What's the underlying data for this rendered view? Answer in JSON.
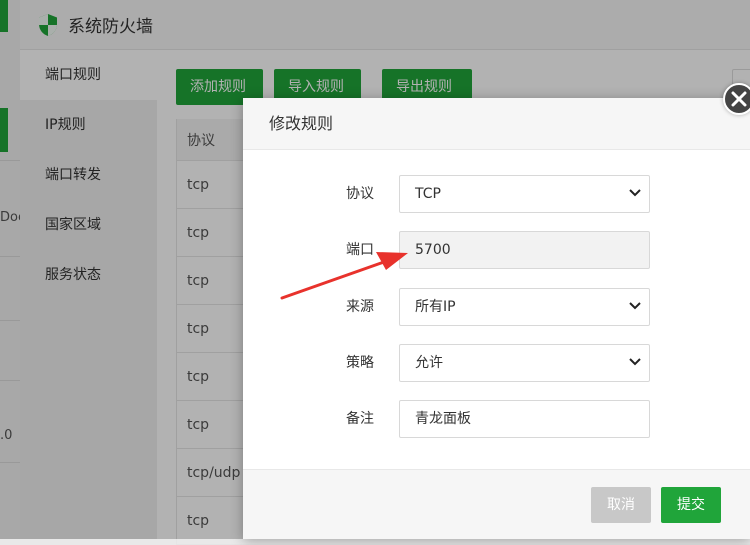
{
  "background_strip": {
    "row_a": "Doc",
    "row_b": ".0"
  },
  "window": {
    "title": "系统防火墙",
    "icon": "shield-icon"
  },
  "sidebar": {
    "items": [
      {
        "label": "端口规则",
        "active": true
      },
      {
        "label": "IP规则",
        "active": false
      },
      {
        "label": "端口转发",
        "active": false
      },
      {
        "label": "国家区域",
        "active": false
      },
      {
        "label": "服务状态",
        "active": false
      }
    ]
  },
  "toolbar": {
    "add_label": "添加规则",
    "import_label": "导入规则",
    "export_label": "导出规则"
  },
  "table": {
    "header": "协议",
    "rows": [
      {
        "protocol": "tcp",
        "tail": "1"
      },
      {
        "protocol": "tcp",
        "tail": "1"
      },
      {
        "protocol": "tcp",
        "tail": "1"
      },
      {
        "protocol": "tcp",
        "tail": "1"
      },
      {
        "protocol": "tcp",
        "tail": "1"
      },
      {
        "protocol": "tcp",
        "tail": "1"
      },
      {
        "protocol": "tcp/udp",
        "tail": "1"
      },
      {
        "protocol": "tcp",
        "tail": "0"
      }
    ]
  },
  "modal": {
    "title": "修改规则",
    "fields": {
      "protocol": {
        "label": "协议",
        "value": "TCP"
      },
      "port": {
        "label": "端口",
        "value": "5700"
      },
      "source": {
        "label": "来源",
        "value": "所有IP"
      },
      "policy": {
        "label": "策略",
        "value": "允许"
      },
      "note": {
        "label": "备注",
        "value": "青龙面板"
      }
    },
    "cancel_label": "取消",
    "submit_label": "提交"
  },
  "colors": {
    "accent": "#20a53a",
    "annotation_arrow": "#e8322c"
  }
}
